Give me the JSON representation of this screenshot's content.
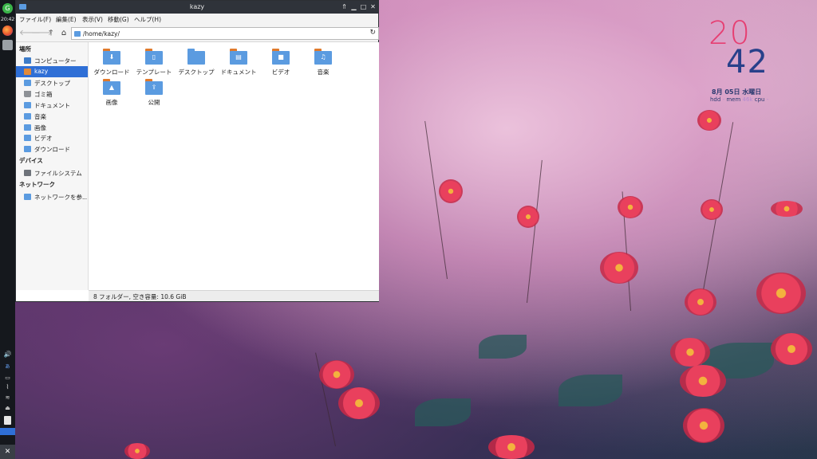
{
  "panel": {
    "clock": "20:42",
    "tray_icons": [
      "speaker-icon",
      "network-icon",
      "window-icon",
      "paperclip-icon",
      "wifi-icon",
      "eject-icon",
      "battery-icon",
      "workspace-icon",
      "start-menu-icon"
    ]
  },
  "conky": {
    "hours": "20",
    "minutes": "42",
    "date": "8月 05日 水曜日",
    "hdd_label": "hdd",
    "hdd_value": "-",
    "mem_label": "mem",
    "mem_value": "46k",
    "cpu_label": "cpu",
    "cpu_value": "-"
  },
  "window": {
    "title": "kazy",
    "menu": [
      "ファイル(F)",
      "編集(E)",
      "表示(V)",
      "移動(G)",
      "ヘルプ(H)"
    ],
    "location": "/home/kazy/",
    "sidebar": {
      "places_header": "場所",
      "places": [
        {
          "label": "コンピューター",
          "icon": "computer-icon"
        },
        {
          "label": "kazy",
          "icon": "home-icon",
          "selected": true
        },
        {
          "label": "デスクトップ",
          "icon": "desktop-icon"
        },
        {
          "label": "ゴミ箱",
          "icon": "trash-icon"
        },
        {
          "label": "ドキュメント",
          "icon": "documents-icon"
        },
        {
          "label": "音楽",
          "icon": "music-icon"
        },
        {
          "label": "画像",
          "icon": "pictures-icon"
        },
        {
          "label": "ビデオ",
          "icon": "videos-icon"
        },
        {
          "label": "ダウンロード",
          "icon": "downloads-icon"
        }
      ],
      "devices_header": "デバイス",
      "devices": [
        {
          "label": "ファイルシステム",
          "icon": "drive-icon"
        }
      ],
      "network_header": "ネットワーク",
      "network": [
        {
          "label": "ネットワークを参...",
          "icon": "network-folder-icon"
        }
      ]
    },
    "files": [
      {
        "name": "ダウンロード",
        "icon": "download-folder-icon",
        "glyph": "⬇"
      },
      {
        "name": "テンプレート",
        "icon": "templates-folder-icon",
        "glyph": "▯"
      },
      {
        "name": "デスクトップ",
        "icon": "desktop-folder-icon",
        "glyph": ""
      },
      {
        "name": "ドキュメント",
        "icon": "documents-folder-icon",
        "glyph": "▤"
      },
      {
        "name": "ビデオ",
        "icon": "videos-folder-icon",
        "glyph": "■"
      },
      {
        "name": "音楽",
        "icon": "music-folder-icon",
        "glyph": "♫"
      },
      {
        "name": "画像",
        "icon": "pictures-folder-icon",
        "glyph": "▲"
      },
      {
        "name": "公開",
        "icon": "public-folder-icon",
        "glyph": "⇪"
      }
    ],
    "status": "8 フォルダー, 空き容量: 10.6 GiB"
  }
}
